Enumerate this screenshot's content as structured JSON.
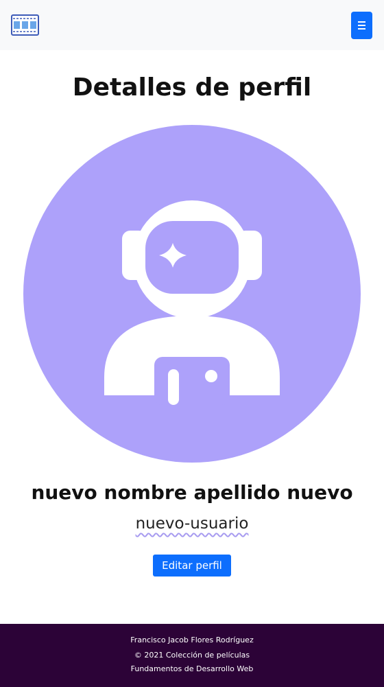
{
  "navbar": {
    "logo_icon": "film-strip-icon",
    "menu_icon": "hamburger-menu-icon",
    "accent_color": "#0d6efd"
  },
  "profile": {
    "title": "Detalles de perfil",
    "avatar_icon": "astronaut-icon",
    "avatar_color": "#ada1fa",
    "full_name": "nuevo nombre apellido nuevo",
    "username": "nuevo-usuario",
    "edit_button_label": "Editar perfil"
  },
  "footer": {
    "author": "Francisco Jacob Flores Rodríguez",
    "copyright": "© 2021 Colección de películas",
    "course": "Fundamentos de Desarrollo Web",
    "background_color": "#2c0337"
  }
}
